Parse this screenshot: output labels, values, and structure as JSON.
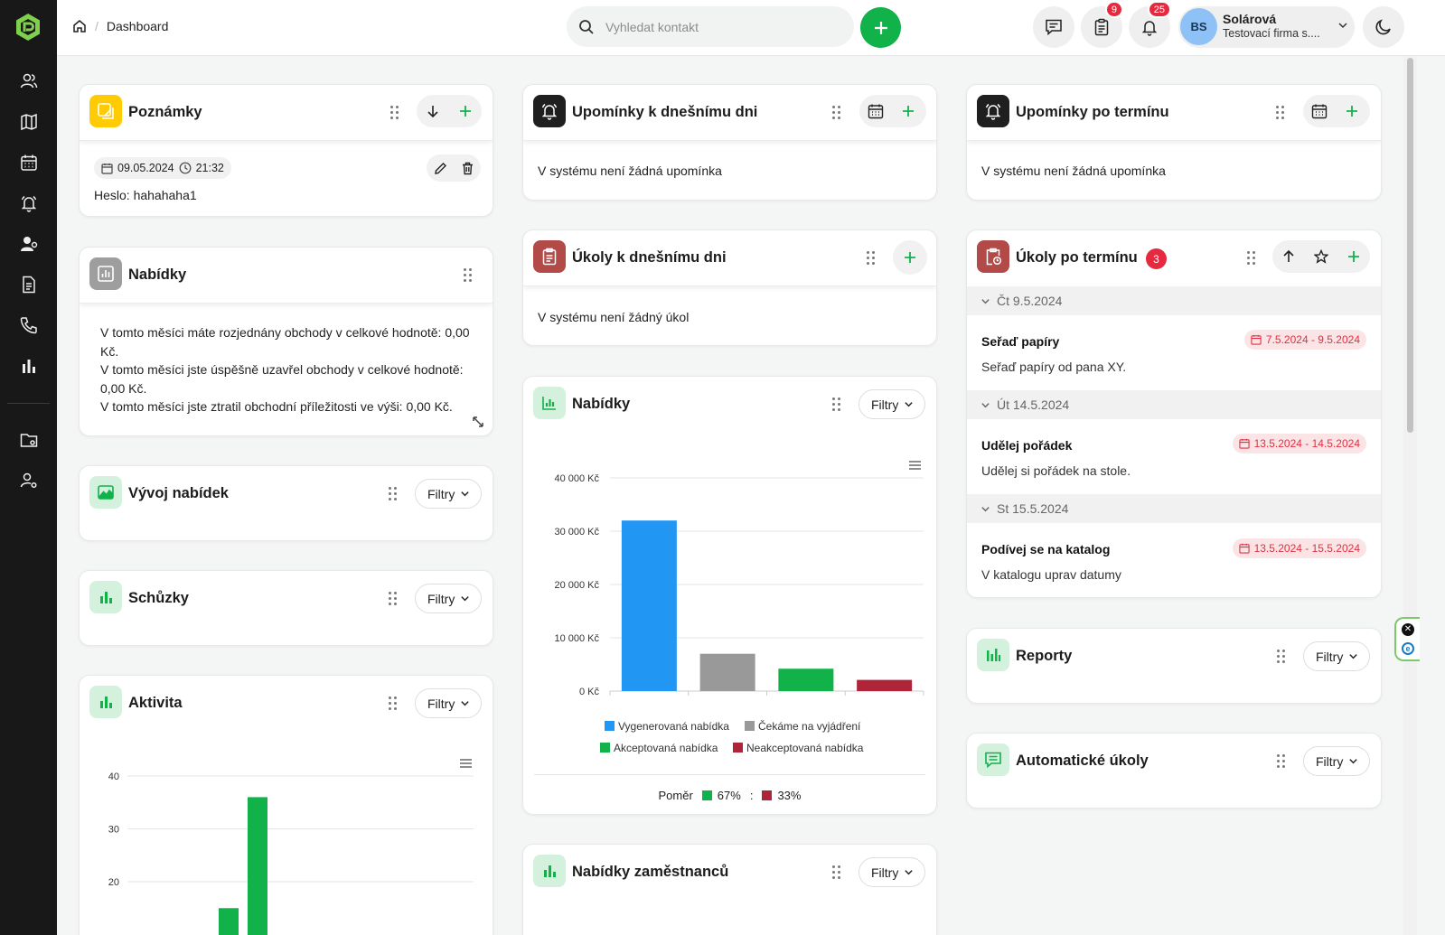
{
  "app": {
    "breadcrumb": "Dashboard",
    "search_placeholder": "Vyhledat kontakt",
    "badges": {
      "tasks": "9",
      "notifications": "25"
    },
    "user": {
      "initials": "BS",
      "name": "Solárová",
      "company": "Testovací firma s...."
    }
  },
  "sidebar": [
    "contacts-icon",
    "map-icon",
    "calendar-icon",
    "bell-icon",
    "user-settings-icon",
    "document-icon",
    "phone-icon",
    "chart-icon",
    "folder-icon",
    "admin-icon"
  ],
  "cards": {
    "poznamky": {
      "title": "Poznámky",
      "note_date": "09.05.2024",
      "note_time": "21:32",
      "note_text": "Heslo: hahahaha1"
    },
    "nabidky_left": {
      "title": "Nabídky",
      "line1": "V tomto měsíci máte rozjednány obchody v celkové hodnotě: 0,00 Kč.",
      "line2": "V tomto měsíci jste úspěšně uzavřel obchody v celkové hodnotě: 0,00 Kč.",
      "line3": "V tomto měsíci jste ztratil obchodní příležitosti ve výši: 0,00 Kč."
    },
    "vyvoj": {
      "title": "Vývoj nabídek",
      "filter": "Filtry"
    },
    "schuzky": {
      "title": "Schůzky",
      "filter": "Filtry"
    },
    "aktivita": {
      "title": "Aktivita",
      "filter": "Filtry"
    },
    "upominky_dnes": {
      "title": "Upomínky k dnešnímu dni",
      "empty": "V systému není žádná upomínka"
    },
    "ukoly_dnes": {
      "title": "Úkoly k dnešnímu dni",
      "empty": "V systému není žádný úkol"
    },
    "nabidky_chart": {
      "title": "Nabídky",
      "filter": "Filtry",
      "ratio_label": "Poměr",
      "ratio_left": "67%",
      "ratio_sep": ":",
      "ratio_right": "33%"
    },
    "nabidky_zam": {
      "title": "Nabídky zaměstnanců",
      "filter": "Filtry"
    },
    "upominky_po": {
      "title": "Upomínky po termínu",
      "empty": "V systému není žádná upomínka"
    },
    "ukoly_po": {
      "title": "Úkoly po termínu",
      "count": "3",
      "groups": [
        {
          "label": "Čt 9.5.2024",
          "task": "Seřaď papíry",
          "desc": "Seřaď papíry od pana XY.",
          "range": "7.5.2024 - 9.5.2024"
        },
        {
          "label": "Út 14.5.2024",
          "task": "Udělej pořádek",
          "desc": "Udělej si pořádek na stole.",
          "range": "13.5.2024 - 14.5.2024"
        },
        {
          "label": "St 15.5.2024",
          "task": "Podívej se na katalog",
          "desc": "V katalogu uprav datumy",
          "range": "13.5.2024 - 15.5.2024"
        }
      ]
    },
    "reporty": {
      "title": "Reporty",
      "filter": "Filtry"
    },
    "auto_ukoly": {
      "title": "Automatické úkoly",
      "filter": "Filtry"
    }
  },
  "chart_data": [
    {
      "type": "bar",
      "categories": [
        "Vygenerovaná nabídka",
        "Čekáme na vyjádření",
        "Akceptovaná nabídka",
        "Neakceptovaná nabídka"
      ],
      "values": [
        32000,
        7000,
        4200,
        2100
      ],
      "colors": [
        "#2196f3",
        "#999999",
        "#12b24b",
        "#b0243a"
      ],
      "ylim": [
        0,
        40000
      ],
      "yticks": [
        "0 Kč",
        "10 000 Kč",
        "20 000 Kč",
        "30 000 Kč",
        "40 000 Kč"
      ],
      "legend": "bottom",
      "grid": true
    },
    {
      "type": "bar",
      "x": [
        1,
        2
      ],
      "values": [
        15,
        36
      ],
      "colors": [
        "#12b24b",
        "#12b24b"
      ],
      "ylim": [
        10,
        40
      ],
      "yticks": [
        "20",
        "30",
        "40"
      ],
      "grid": true
    }
  ]
}
